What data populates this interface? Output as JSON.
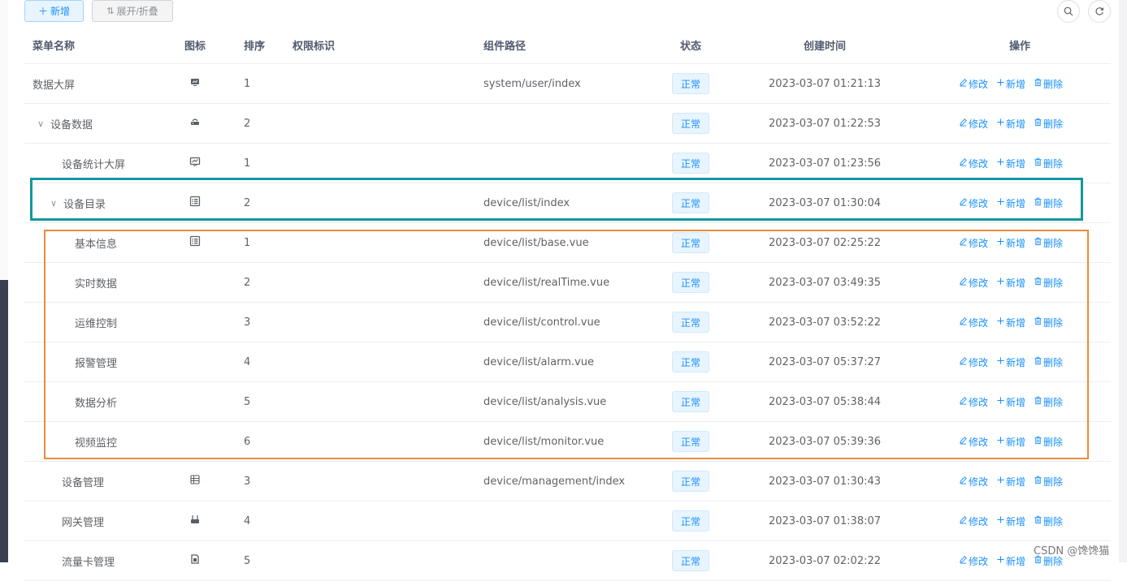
{
  "toolbar": {
    "add_label": "新增",
    "toggle_label": "展开/折叠"
  },
  "table": {
    "headers": {
      "name": "菜单名称",
      "icon": "图标",
      "order": "排序",
      "perm": "权限标识",
      "path": "组件路径",
      "status": "状态",
      "time": "创建时间",
      "ops": "操作"
    },
    "op_labels": {
      "edit": "修改",
      "add": "新增",
      "delete": "删除"
    },
    "rows": [
      {
        "name": "数据大屏",
        "icon": "monitor-icon",
        "order": "1",
        "path": "system/user/index",
        "status": "正常",
        "time": "2023-03-07 01:21:13",
        "indent": 0,
        "expanded": false
      },
      {
        "name": "设备数据",
        "icon": "router-icon",
        "order": "2",
        "path": "",
        "status": "正常",
        "time": "2023-03-07 01:22:53",
        "indent": 1,
        "expanded": true
      },
      {
        "name": "设备统计大屏",
        "icon": "chart-monitor-icon",
        "order": "1",
        "path": "",
        "status": "正常",
        "time": "2023-03-07 01:23:56",
        "indent": 2,
        "expanded": false
      },
      {
        "name": "设备目录",
        "icon": "list-icon",
        "order": "2",
        "path": "device/list/index",
        "status": "正常",
        "time": "2023-03-07 01:30:04",
        "indent": 3,
        "expanded": true
      },
      {
        "name": "基本信息",
        "icon": "list-icon",
        "order": "1",
        "path": "device/list/base.vue",
        "status": "正常",
        "time": "2023-03-07 02:25:22",
        "indent": 4,
        "expanded": false
      },
      {
        "name": "实时数据",
        "icon": "",
        "order": "2",
        "path": "device/list/realTime.vue",
        "status": "正常",
        "time": "2023-03-07 03:49:35",
        "indent": 4,
        "expanded": false
      },
      {
        "name": "运维控制",
        "icon": "",
        "order": "3",
        "path": "device/list/control.vue",
        "status": "正常",
        "time": "2023-03-07 03:52:22",
        "indent": 4,
        "expanded": false
      },
      {
        "name": "报警管理",
        "icon": "",
        "order": "4",
        "path": "device/list/alarm.vue",
        "status": "正常",
        "time": "2023-03-07 05:37:27",
        "indent": 4,
        "expanded": false
      },
      {
        "name": "数据分析",
        "icon": "",
        "order": "5",
        "path": "device/list/analysis.vue",
        "status": "正常",
        "time": "2023-03-07 05:38:44",
        "indent": 4,
        "expanded": false
      },
      {
        "name": "视频监控",
        "icon": "",
        "order": "6",
        "path": "device/list/monitor.vue",
        "status": "正常",
        "time": "2023-03-07 05:39:36",
        "indent": 4,
        "expanded": false
      },
      {
        "name": "设备管理",
        "icon": "table-icon",
        "order": "3",
        "path": "device/management/index",
        "status": "正常",
        "time": "2023-03-07 01:30:43",
        "indent": 2,
        "expanded": false
      },
      {
        "name": "网关管理",
        "icon": "gateway-icon",
        "order": "4",
        "path": "",
        "status": "正常",
        "time": "2023-03-07 01:38:07",
        "indent": 2,
        "expanded": false
      },
      {
        "name": "流量卡管理",
        "icon": "sim-card-icon",
        "order": "5",
        "path": "",
        "status": "正常",
        "time": "2023-03-07 02:02:22",
        "indent": 2,
        "expanded": false
      }
    ]
  },
  "watermark": "CSDN @馋馋猫",
  "colors": {
    "primary": "#1890ff",
    "teal_box": "#13979e",
    "orange_box": "#ee8a3a"
  }
}
